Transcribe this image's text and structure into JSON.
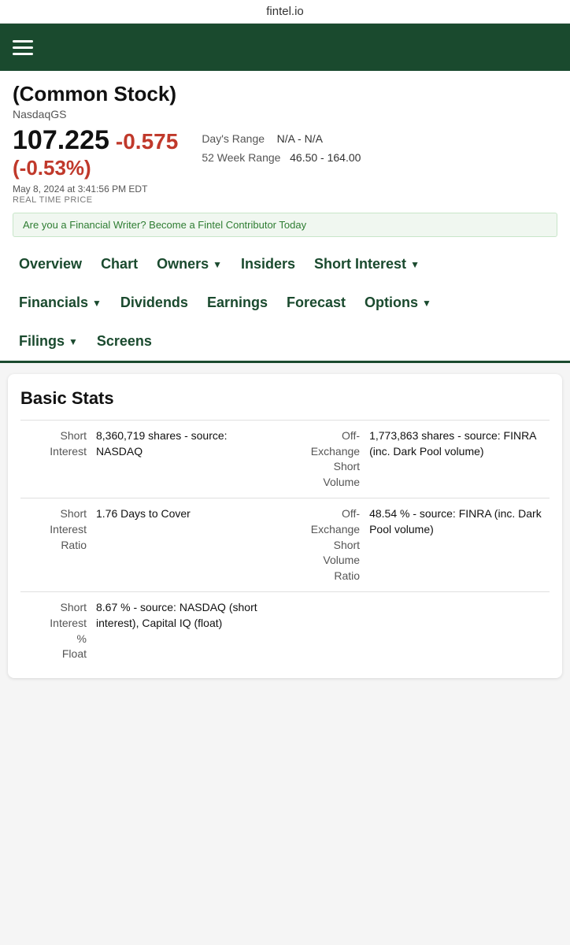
{
  "topbar": {
    "domain": "fintel.io"
  },
  "header": {
    "hamburger_label": "menu"
  },
  "stock": {
    "title": "(Common Stock)",
    "exchange": "NasdaqGS",
    "price": "107.225",
    "change": "-0.575",
    "pct_change": "(-0.53%)",
    "timestamp": "May 8, 2024 at 3:41:56 PM EDT",
    "realtime_label": "REAL TIME PRICE",
    "days_range_label": "Day's Range",
    "days_range_value": "N/A - N/A",
    "week_range_label": "52 Week Range",
    "week_range_value": "46.50 - 164.00",
    "promo": "Are you a Financial Writer? Become a Fintel Contributor Today"
  },
  "nav": {
    "rows": [
      [
        {
          "label": "Overview",
          "has_dropdown": false
        },
        {
          "label": "Chart",
          "has_dropdown": false
        },
        {
          "label": "Owners",
          "has_dropdown": true
        },
        {
          "label": "Insiders",
          "has_dropdown": false
        },
        {
          "label": "Short Interest",
          "has_dropdown": true
        }
      ],
      [
        {
          "label": "Financials",
          "has_dropdown": true
        },
        {
          "label": "Dividends",
          "has_dropdown": false
        },
        {
          "label": "Earnings",
          "has_dropdown": false
        },
        {
          "label": "Forecast",
          "has_dropdown": false
        },
        {
          "label": "Options",
          "has_dropdown": true
        }
      ],
      [
        {
          "label": "Filings",
          "has_dropdown": true
        },
        {
          "label": "Screens",
          "has_dropdown": false
        }
      ]
    ]
  },
  "basic_stats": {
    "title": "Basic Stats",
    "left_rows": [
      {
        "label": "Short Interest",
        "value": "8,360,719 shares - source: NASDAQ"
      },
      {
        "label": "Short Interest Ratio",
        "value": "1.76 Days to Cover"
      },
      {
        "label": "Short Interest % Float",
        "value": "8.67 % - source: NASDAQ (short interest), Capital IQ (float)"
      }
    ],
    "right_rows": [
      {
        "label": "Off-Exchange Short Volume",
        "value": "1,773,863 shares - source: FINRA (inc. Dark Pool volume)"
      },
      {
        "label": "Off-Exchange Short Volume Ratio",
        "value": "48.54 % - source: FINRA (inc. Dark Pool volume)"
      }
    ]
  }
}
